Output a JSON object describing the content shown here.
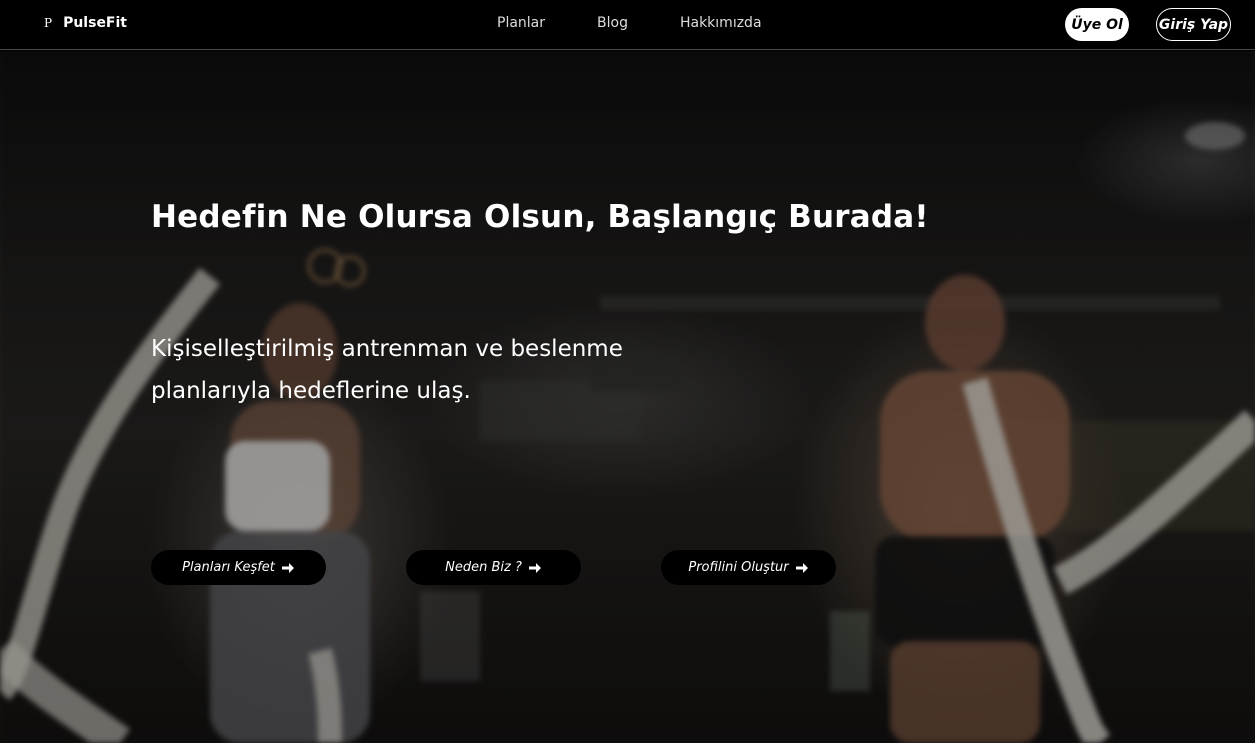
{
  "brand": {
    "logo": "P",
    "name": "PulseFit"
  },
  "nav": {
    "links": [
      "Planlar",
      "Blog",
      "Hakkımızda"
    ]
  },
  "auth": {
    "signup": "Üye Ol",
    "login": "Giriş Yap"
  },
  "hero": {
    "title": "Hedefin Ne Olursa Olsun, Başlangıç Burada!",
    "subtitle": "Kişiselleştirilmiş antrenman ve beslenme planlarıyla hedeflerine ulaş.",
    "buttons": [
      "Planları Keşfet",
      "Neden Biz ?",
      "Profilini Oluştur"
    ],
    "button_icon": "arrow-right-icon"
  },
  "colors": {
    "navbar_bg": "#000000",
    "button_bg": "#000000",
    "text": "#ffffff"
  }
}
